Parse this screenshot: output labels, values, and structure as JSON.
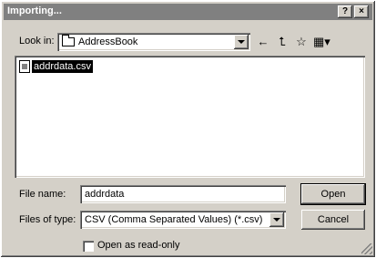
{
  "window": {
    "title": "Importing...",
    "help_label": "?",
    "close_label": "×"
  },
  "look_in": {
    "label": "Look in:",
    "value": "AddressBook"
  },
  "toolbar": {
    "back_icon": "←",
    "up_icon": "⮤",
    "new_folder_icon": "☆",
    "views_icon": "▦▾"
  },
  "files": [
    {
      "name": "addrdata.csv",
      "selected": true
    }
  ],
  "file_name": {
    "label": "File name:",
    "value": "addrdata"
  },
  "file_type": {
    "label": "Files of type:",
    "value": "CSV (Comma Separated Values) (*.csv)"
  },
  "buttons": {
    "open": "Open",
    "cancel": "Cancel"
  },
  "read_only": {
    "label": "Open as read-only",
    "checked": false
  },
  "colors": {
    "title_bar": "#808080",
    "face": "#d4d0c8",
    "selection": "#000000"
  }
}
